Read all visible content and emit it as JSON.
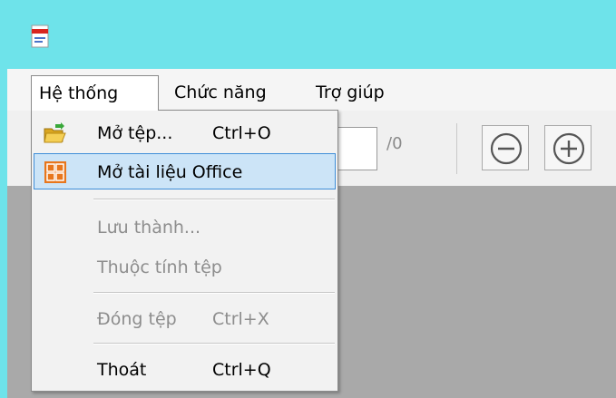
{
  "app_icon": "pdf-document-icon",
  "menubar": {
    "items": [
      "Hệ thống",
      "Chức năng",
      "Trợ giúp"
    ]
  },
  "toolbar": {
    "page_count": "/0",
    "zoom_out_icon": "zoom-out-icon",
    "zoom_in_icon": "zoom-in-icon"
  },
  "dropdown": {
    "open_label": "Mở tệp...",
    "open_shortcut": "Ctrl+O",
    "open_icon": "folder-open-icon",
    "office_label": "Mở tài liệu Office",
    "office_icon": "office-document-icon",
    "saveas_label": "Lưu thành...",
    "properties_label": "Thuộc tính tệp",
    "close_label": "Đóng tệp",
    "close_shortcut": "Ctrl+X",
    "exit_label": "Thoát",
    "exit_shortcut": "Ctrl+Q"
  },
  "colors": {
    "titlebar": "#6ee3ea",
    "highlight_bg": "#cce4f7",
    "highlight_border": "#3f8ed8",
    "document_area": "#a9a9a9"
  }
}
